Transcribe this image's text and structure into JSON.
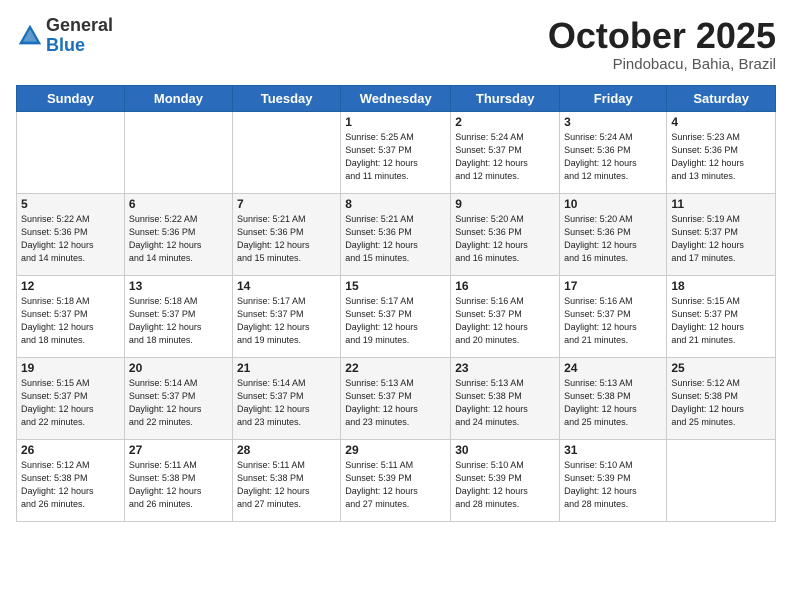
{
  "logo": {
    "general": "General",
    "blue": "Blue"
  },
  "title": "October 2025",
  "location": "Pindobacu, Bahia, Brazil",
  "headers": [
    "Sunday",
    "Monday",
    "Tuesday",
    "Wednesday",
    "Thursday",
    "Friday",
    "Saturday"
  ],
  "weeks": [
    [
      {
        "day": "",
        "info": ""
      },
      {
        "day": "",
        "info": ""
      },
      {
        "day": "",
        "info": ""
      },
      {
        "day": "1",
        "info": "Sunrise: 5:25 AM\nSunset: 5:37 PM\nDaylight: 12 hours\nand 11 minutes."
      },
      {
        "day": "2",
        "info": "Sunrise: 5:24 AM\nSunset: 5:37 PM\nDaylight: 12 hours\nand 12 minutes."
      },
      {
        "day": "3",
        "info": "Sunrise: 5:24 AM\nSunset: 5:36 PM\nDaylight: 12 hours\nand 12 minutes."
      },
      {
        "day": "4",
        "info": "Sunrise: 5:23 AM\nSunset: 5:36 PM\nDaylight: 12 hours\nand 13 minutes."
      }
    ],
    [
      {
        "day": "5",
        "info": "Sunrise: 5:22 AM\nSunset: 5:36 PM\nDaylight: 12 hours\nand 14 minutes."
      },
      {
        "day": "6",
        "info": "Sunrise: 5:22 AM\nSunset: 5:36 PM\nDaylight: 12 hours\nand 14 minutes."
      },
      {
        "day": "7",
        "info": "Sunrise: 5:21 AM\nSunset: 5:36 PM\nDaylight: 12 hours\nand 15 minutes."
      },
      {
        "day": "8",
        "info": "Sunrise: 5:21 AM\nSunset: 5:36 PM\nDaylight: 12 hours\nand 15 minutes."
      },
      {
        "day": "9",
        "info": "Sunrise: 5:20 AM\nSunset: 5:36 PM\nDaylight: 12 hours\nand 16 minutes."
      },
      {
        "day": "10",
        "info": "Sunrise: 5:20 AM\nSunset: 5:36 PM\nDaylight: 12 hours\nand 16 minutes."
      },
      {
        "day": "11",
        "info": "Sunrise: 5:19 AM\nSunset: 5:37 PM\nDaylight: 12 hours\nand 17 minutes."
      }
    ],
    [
      {
        "day": "12",
        "info": "Sunrise: 5:18 AM\nSunset: 5:37 PM\nDaylight: 12 hours\nand 18 minutes."
      },
      {
        "day": "13",
        "info": "Sunrise: 5:18 AM\nSunset: 5:37 PM\nDaylight: 12 hours\nand 18 minutes."
      },
      {
        "day": "14",
        "info": "Sunrise: 5:17 AM\nSunset: 5:37 PM\nDaylight: 12 hours\nand 19 minutes."
      },
      {
        "day": "15",
        "info": "Sunrise: 5:17 AM\nSunset: 5:37 PM\nDaylight: 12 hours\nand 19 minutes."
      },
      {
        "day": "16",
        "info": "Sunrise: 5:16 AM\nSunset: 5:37 PM\nDaylight: 12 hours\nand 20 minutes."
      },
      {
        "day": "17",
        "info": "Sunrise: 5:16 AM\nSunset: 5:37 PM\nDaylight: 12 hours\nand 21 minutes."
      },
      {
        "day": "18",
        "info": "Sunrise: 5:15 AM\nSunset: 5:37 PM\nDaylight: 12 hours\nand 21 minutes."
      }
    ],
    [
      {
        "day": "19",
        "info": "Sunrise: 5:15 AM\nSunset: 5:37 PM\nDaylight: 12 hours\nand 22 minutes."
      },
      {
        "day": "20",
        "info": "Sunrise: 5:14 AM\nSunset: 5:37 PM\nDaylight: 12 hours\nand 22 minutes."
      },
      {
        "day": "21",
        "info": "Sunrise: 5:14 AM\nSunset: 5:37 PM\nDaylight: 12 hours\nand 23 minutes."
      },
      {
        "day": "22",
        "info": "Sunrise: 5:13 AM\nSunset: 5:37 PM\nDaylight: 12 hours\nand 23 minutes."
      },
      {
        "day": "23",
        "info": "Sunrise: 5:13 AM\nSunset: 5:38 PM\nDaylight: 12 hours\nand 24 minutes."
      },
      {
        "day": "24",
        "info": "Sunrise: 5:13 AM\nSunset: 5:38 PM\nDaylight: 12 hours\nand 25 minutes."
      },
      {
        "day": "25",
        "info": "Sunrise: 5:12 AM\nSunset: 5:38 PM\nDaylight: 12 hours\nand 25 minutes."
      }
    ],
    [
      {
        "day": "26",
        "info": "Sunrise: 5:12 AM\nSunset: 5:38 PM\nDaylight: 12 hours\nand 26 minutes."
      },
      {
        "day": "27",
        "info": "Sunrise: 5:11 AM\nSunset: 5:38 PM\nDaylight: 12 hours\nand 26 minutes."
      },
      {
        "day": "28",
        "info": "Sunrise: 5:11 AM\nSunset: 5:38 PM\nDaylight: 12 hours\nand 27 minutes."
      },
      {
        "day": "29",
        "info": "Sunrise: 5:11 AM\nSunset: 5:39 PM\nDaylight: 12 hours\nand 27 minutes."
      },
      {
        "day": "30",
        "info": "Sunrise: 5:10 AM\nSunset: 5:39 PM\nDaylight: 12 hours\nand 28 minutes."
      },
      {
        "day": "31",
        "info": "Sunrise: 5:10 AM\nSunset: 5:39 PM\nDaylight: 12 hours\nand 28 minutes."
      },
      {
        "day": "",
        "info": ""
      }
    ]
  ]
}
